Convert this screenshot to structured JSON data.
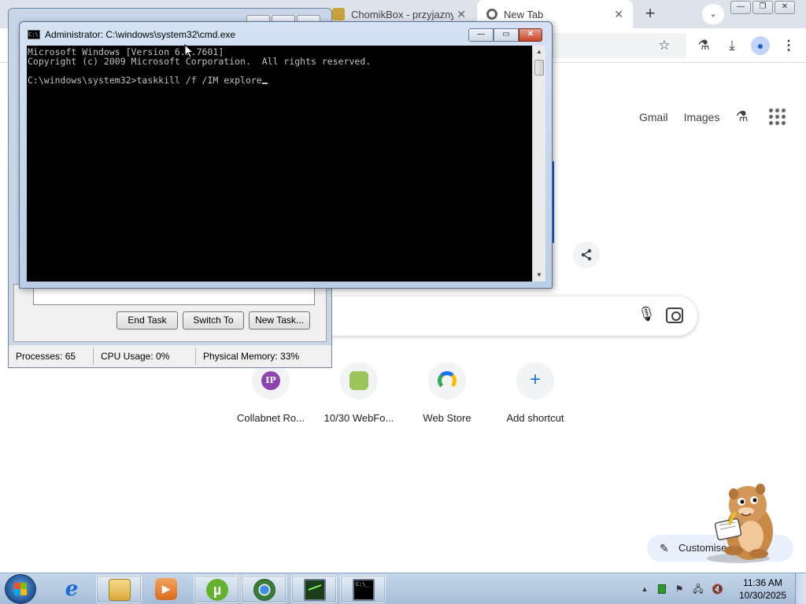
{
  "chrome": {
    "tabs": [
      {
        "title": "ChomikBox - przyjazny p",
        "active": false
      },
      {
        "title": "New Tab",
        "active": true
      }
    ],
    "new_tab_symbol": "+",
    "tab_search_symbol": "⌄",
    "window_controls": {
      "minimize": "—",
      "maximize": "❐",
      "close": "✕"
    },
    "ntp": {
      "links": {
        "gmail": "Gmail",
        "images": "Images"
      },
      "shortcuts": [
        {
          "label": "Collabnet Ro...",
          "icon_text": "IP"
        },
        {
          "label": "10/30 WebFo...",
          "icon_text": ""
        },
        {
          "label": "Web Store",
          "icon_text": ""
        },
        {
          "label": "Add shortcut",
          "icon_text": "+"
        }
      ],
      "customise_label": "Customise Chrome"
    }
  },
  "task_manager": {
    "buttons": {
      "end_task": "End Task",
      "switch_to": "Switch To",
      "new_task": "New Task..."
    },
    "status": {
      "processes": "Processes: 65",
      "cpu": "CPU Usage: 0%",
      "memory": "Physical Memory: 33%"
    }
  },
  "cmd": {
    "title": "Administrator: C:\\windows\\system32\\cmd.exe",
    "icon_text": "C:\\",
    "lines": [
      "Microsoft Windows [Version 6.1.7601]",
      "Copyright (c) 2009 Microsoft Corporation.  All rights reserved.",
      "",
      "C:\\windows\\system32>taskkill /f /IM explore"
    ]
  },
  "taskbar": {
    "apps": [
      {
        "name": "Internet Explorer",
        "icon_text": "e"
      },
      {
        "name": "Windows Explorer",
        "icon_text": ""
      },
      {
        "name": "Media Player",
        "icon_text": "▶"
      },
      {
        "name": "uTorrent",
        "icon_text": "µ"
      },
      {
        "name": "Google Chrome",
        "icon_text": ""
      },
      {
        "name": "Task Manager",
        "icon_text": ""
      },
      {
        "name": "Command Prompt",
        "icon_text": "C:\\_"
      }
    ],
    "clock": {
      "time": "11:36 AM",
      "date": "10/30/2025"
    },
    "tray_arrow": "▲"
  },
  "colors": {
    "cmd_background": "#000000",
    "cmd_text": "#c0c0c0",
    "chrome_tabstrip": "#dee3eb",
    "taskbar": "#b6c9e0",
    "customise_button": "#e8f0fe"
  }
}
